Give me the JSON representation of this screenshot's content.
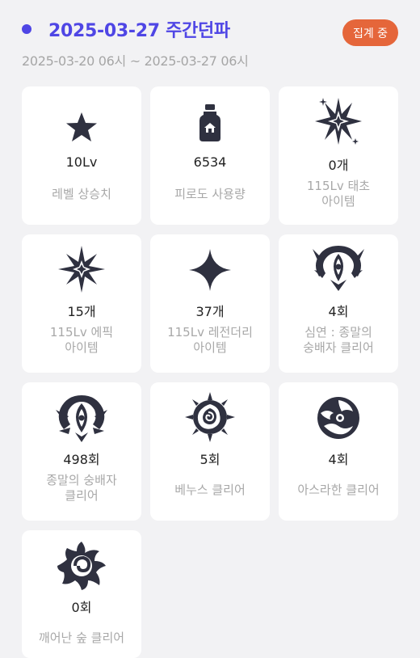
{
  "header": {
    "title": "2025-03-27 주간던파",
    "badge": "집계 중",
    "range": "2025-03-20 06시 ~ 2025-03-27 06시"
  },
  "colors": {
    "accent": "#4f46e5",
    "badge": "#e5663a",
    "icon": "#2f3140"
  },
  "stats": [
    {
      "icon": "star-icon",
      "value": "10Lv",
      "label": "레벨 상승치"
    },
    {
      "icon": "potion-bottle-icon",
      "value": "6534",
      "label": "피로도 사용량"
    },
    {
      "icon": "burst-star-icon",
      "value": "0개",
      "label": "115Lv 태초\n아이템"
    },
    {
      "icon": "sparkle-cross-icon",
      "value": "15개",
      "label": "115Lv 에픽\n아이템"
    },
    {
      "icon": "four-point-star-icon",
      "value": "37개",
      "label": "115Lv 레전더리\n아이템"
    },
    {
      "icon": "deep-abyss-emblem-icon",
      "value": "4회",
      "label": "심연 : 종말의\n숭배자 클리어"
    },
    {
      "icon": "cultist-emblem-icon",
      "value": "498회",
      "label": "종말의 숭배자\n클리어"
    },
    {
      "icon": "venus-rose-icon",
      "value": "5회",
      "label": "베누스 클리어"
    },
    {
      "icon": "wave-circle-icon",
      "value": "4회",
      "label": "아스라한 클리어"
    },
    {
      "icon": "swirl-eye-icon",
      "value": "0회",
      "label": "깨어난 숲 클리어"
    }
  ]
}
